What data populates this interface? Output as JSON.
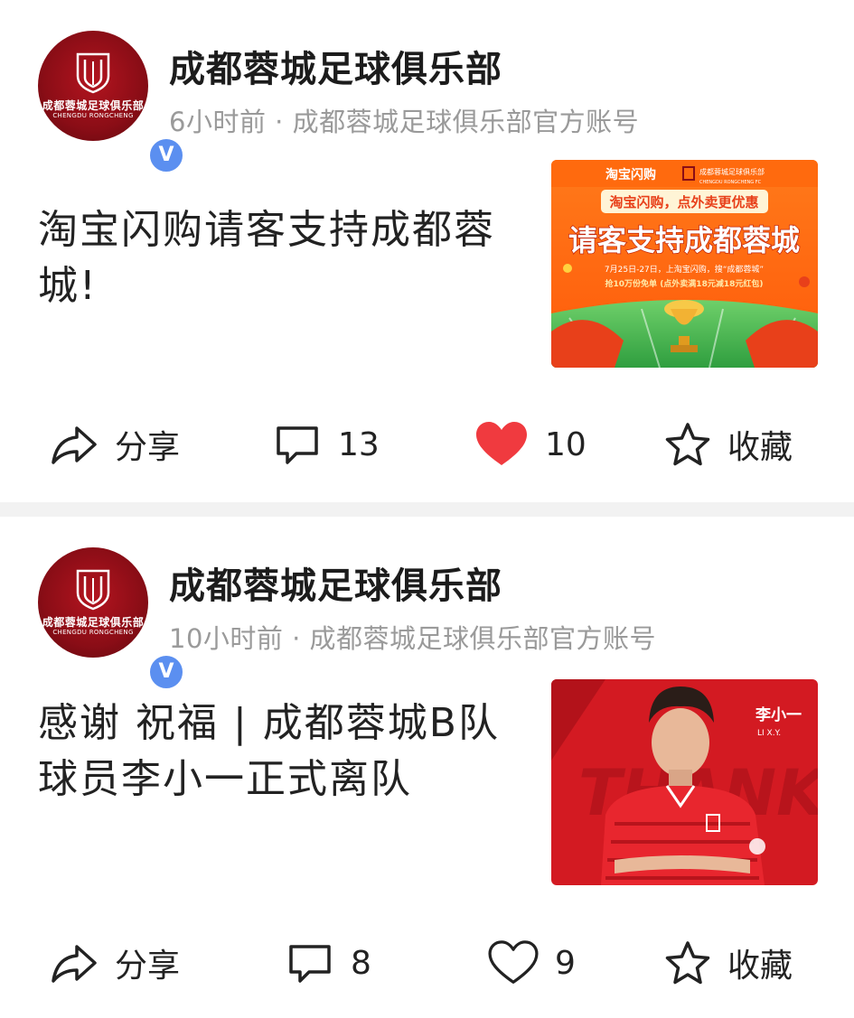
{
  "posts": [
    {
      "author": "成都蓉城足球俱乐部",
      "avatar": {
        "name_cn": "成都蓉城足球俱乐部",
        "name_en": "CHENGDU RONGCHENG",
        "verified_mark": "V"
      },
      "meta": "6小时前 · 成都蓉城足球俱乐部官方账号",
      "title": "淘宝闪购请客支持成都蓉城!",
      "thumbnail": {
        "brand_left": "淘宝闪购",
        "brand_right": "成都蓉城足球俱乐部",
        "brand_right_en": "CHENGDU RONGCHENG FC",
        "tagline": "淘宝闪购，点外卖更优惠",
        "headline": "请客支持成都蓉城",
        "detail_line1": "7月25日-27日，上淘宝闪购，搜“成都蓉城”",
        "detail_line2": "抢10万份免单 (点外卖满18元减18元红包)"
      },
      "actions": {
        "share": "分享",
        "comments": "13",
        "likes": "10",
        "favorite": "收藏",
        "liked": true
      }
    },
    {
      "author": "成都蓉城足球俱乐部",
      "avatar": {
        "name_cn": "成都蓉城足球俱乐部",
        "name_en": "CHENGDU RONGCHENG",
        "verified_mark": "V"
      },
      "meta": "10小时前 · 成都蓉城足球俱乐部官方账号",
      "title": "感谢 祝福 | 成都蓉城B队球员李小一正式离队",
      "thumbnail": {
        "player_name": "李小一",
        "player_name_en": "LI X.Y.",
        "bg_word": "THANK"
      },
      "actions": {
        "share": "分享",
        "comments": "8",
        "likes": "9",
        "favorite": "收藏",
        "liked": false
      }
    }
  ],
  "colors": {
    "like_red": "#f03a3f",
    "club_red": "#b3141f",
    "verified_blue": "#5b8ff0",
    "meta_gray": "#9a9a9a"
  }
}
